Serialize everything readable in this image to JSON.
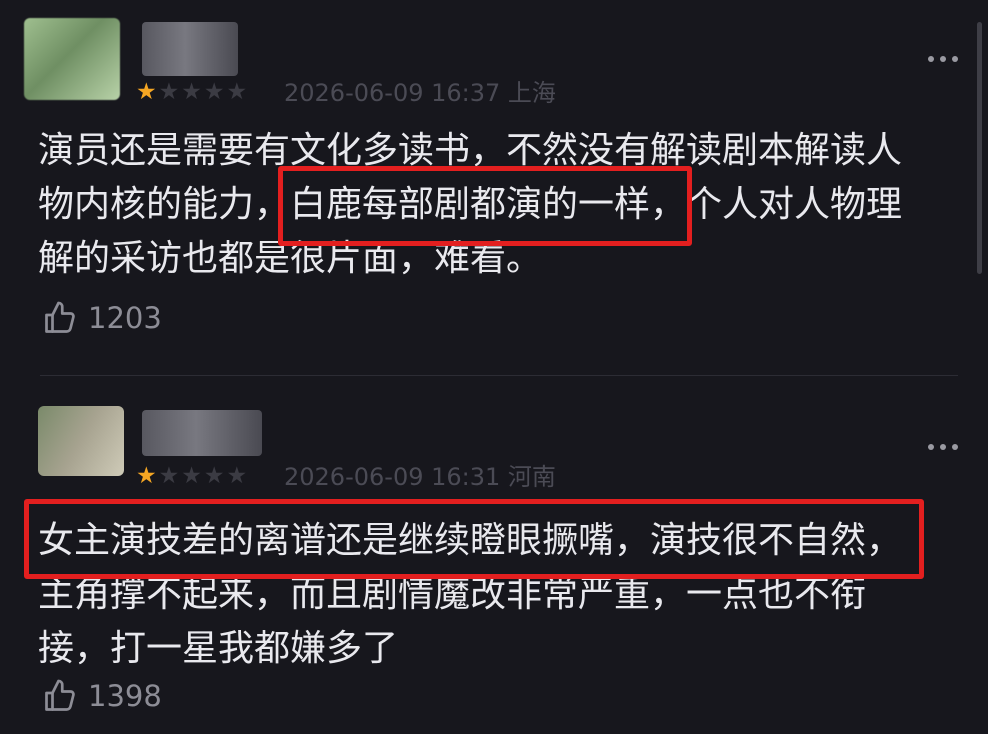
{
  "comments": [
    {
      "rating": 1,
      "timestamp": "2026-06-09 16:37",
      "location": "上海",
      "lines": [
        "演员还是需要有文化多读书，不然没有解读剧本解读人",
        "物内核的能力，白鹿每部剧都演的一样，个人对人物理",
        "解的采访也都是很片面，难看。"
      ],
      "highlight": "白鹿每部剧都演的一样，",
      "likes": "1203"
    },
    {
      "rating": 1,
      "timestamp": "2026-06-09 16:31",
      "location": "河南",
      "lines": [
        "女主演技差的离谱还是继续瞪眼撅嘴，演技很不自然，",
        "主角撑不起来，而且剧情魔改非常严重，一点也不衔",
        "接，打一星我都嫌多了"
      ],
      "highlight": "女主演技差的离谱还是继续瞪眼撅嘴，演技很不自然，",
      "likes": "1398"
    }
  ],
  "colors": {
    "background": "#17171d",
    "star_on": "#f5a623",
    "highlight_border": "#e31f1f"
  },
  "icons": {
    "like": "thumbs-up-icon",
    "more": "more-dots-icon"
  }
}
